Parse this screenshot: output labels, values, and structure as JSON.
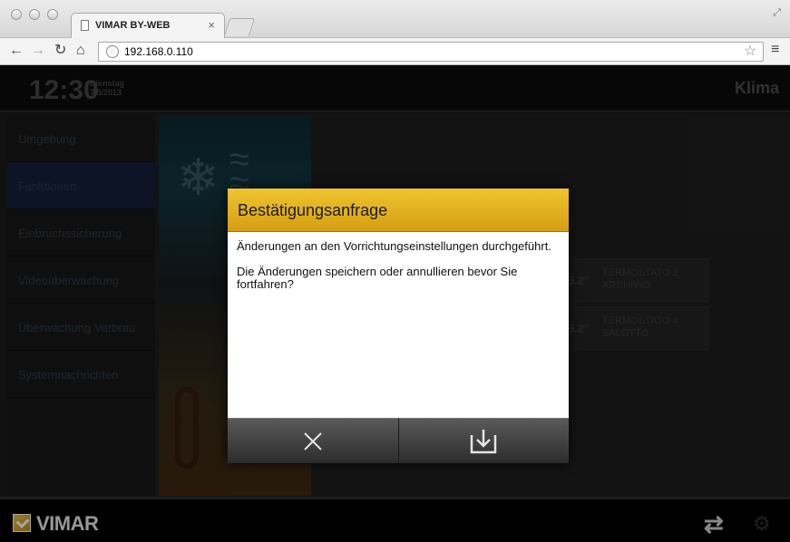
{
  "browser": {
    "tab_title": "VIMAR BY-WEB",
    "tab_close": "×",
    "url": "192.168.0.110"
  },
  "app": {
    "time": "12:30",
    "day_name": "Dienstag",
    "date": "7/5/2013",
    "section": "Klima",
    "sidebar": [
      {
        "label": "Umgebung",
        "active": false
      },
      {
        "label": "Funktionen",
        "active": true
      },
      {
        "label": "Einbruchssicherung",
        "active": false
      },
      {
        "label": "Videoüberwachung",
        "active": false
      },
      {
        "label": "Überwachung Verbrau",
        "active": false
      },
      {
        "label": "Systemnachrichten",
        "active": false
      }
    ],
    "tiles": [
      {
        "temp": "5.2°",
        "name_line1": "TERMOSTATO 2",
        "name_line2": "ARCHIVIO"
      },
      {
        "temp": "5.2°",
        "name_line1": "TERMOSTATO 4",
        "name_line2": "SALOTTO"
      }
    ],
    "footer_logo": "VIMAR"
  },
  "dialog": {
    "title": "Bestätigungsanfrage",
    "message_1": "Änderungen an den Vorrichtungseinstellungen durchgeführt.",
    "message_2": "Die Änderungen speichern oder annullieren bevor Sie fortfahren?",
    "cancel_icon": "close-icon",
    "save_icon": "save-download-icon"
  },
  "colors": {
    "dialog_header": "#e0b023",
    "button_dark": "#3a3a3a",
    "active_sidebar": "#15203a"
  }
}
